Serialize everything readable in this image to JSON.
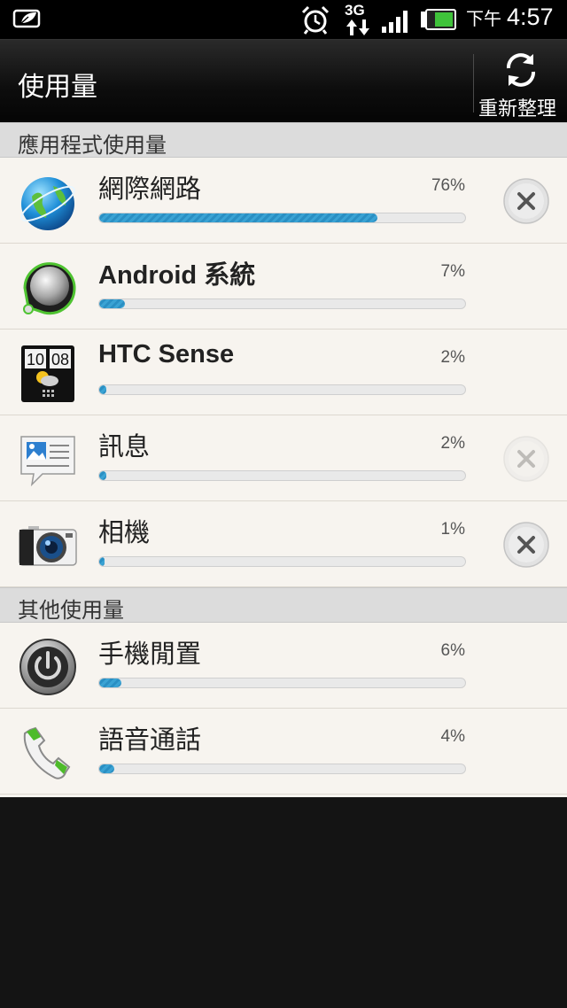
{
  "status_bar": {
    "left_icon": "htc-leaf-icon",
    "network": "3G",
    "ampm": "下午",
    "time": "4:57"
  },
  "title_bar": {
    "title": "使用量",
    "refresh_label": "重新整理"
  },
  "sections": [
    {
      "header": "應用程式使用量",
      "items": [
        {
          "name": "網際網路",
          "percent": "76%",
          "value": 76,
          "icon": "globe-icon",
          "close": "enabled"
        },
        {
          "name": "Android 系統",
          "percent": "7%",
          "value": 7,
          "icon": "android-system-icon",
          "close": "none"
        },
        {
          "name": "HTC Sense",
          "percent": "2%",
          "value": 2,
          "icon": "htc-clock-icon",
          "close": "none",
          "clock_text": "10 08"
        },
        {
          "name": "訊息",
          "percent": "2%",
          "value": 2,
          "icon": "messages-icon",
          "close": "disabled"
        },
        {
          "name": "相機",
          "percent": "1%",
          "value": 1,
          "icon": "camera-icon",
          "close": "enabled"
        }
      ]
    },
    {
      "header": "其他使用量",
      "items": [
        {
          "name": "手機閒置",
          "percent": "6%",
          "value": 6,
          "icon": "power-icon",
          "close": "none"
        },
        {
          "name": "語音通話",
          "percent": "4%",
          "value": 4,
          "icon": "phone-handset-icon",
          "close": "none"
        }
      ]
    }
  ],
  "colors": {
    "bar_fill": "#3aa3d4",
    "list_bg": "#f7f4ef",
    "header_bg": "#dcdcdc"
  }
}
